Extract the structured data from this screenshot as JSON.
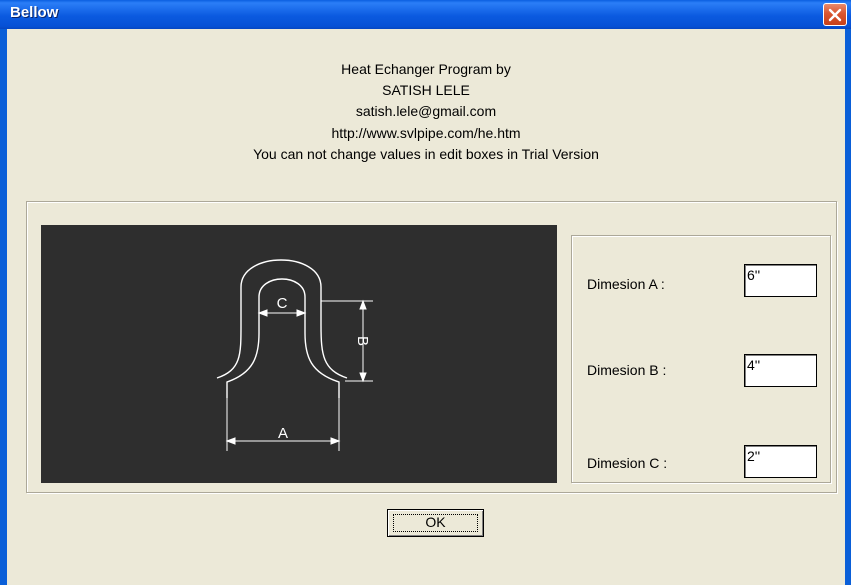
{
  "window": {
    "title": "Bellow"
  },
  "info": {
    "lines": [
      "Heat Echanger Program by",
      "SATISH LELE",
      "satish.lele@gmail.com",
      "http://www.svlpipe.com/he.htm",
      "You can not change values in edit boxes in Trial Version"
    ]
  },
  "drawing": {
    "labels": {
      "a": "A",
      "b": "B",
      "c": "C"
    }
  },
  "dimensions": [
    {
      "label": "Dimesion A :",
      "value": "6''"
    },
    {
      "label": "Dimesion B :",
      "value": "4''"
    },
    {
      "label": "Dimesion C :",
      "value": "2''"
    }
  ],
  "buttons": {
    "ok_label": "OK"
  },
  "colors": {
    "titlebar": "#0a5fd8",
    "dialog_bg": "#ece9d8",
    "drawing_bg": "#2e2e2e",
    "close_button": "#d9552f"
  },
  "icons": {
    "close": "close-x-icon"
  }
}
